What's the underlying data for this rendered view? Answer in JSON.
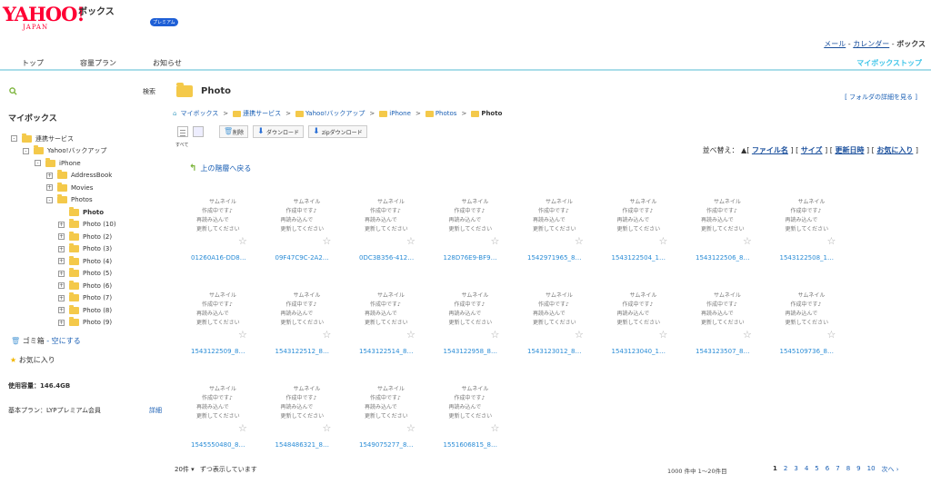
{
  "header": {
    "logo": "YAHOO!",
    "logo_sub": "JAPAN",
    "service": "ボックス",
    "premium_badge": "プレミアム",
    "links": {
      "mail": "メール",
      "calendar": "カレンダー",
      "box": "ボックス",
      "sep": " - "
    },
    "nav": [
      "トップ",
      "容量プラン",
      "お知らせ"
    ],
    "mybox_top": "マイボックストップ"
  },
  "sidebar": {
    "search_button": "検索",
    "title": "マイボックス",
    "tree": [
      {
        "label": "連携サービス",
        "toggle": "-",
        "level": 0
      },
      {
        "label": "Yahoo!バックアップ",
        "toggle": "-",
        "level": 1
      },
      {
        "label": "iPhone",
        "toggle": "-",
        "level": 2
      },
      {
        "label": "AddressBook",
        "toggle": "+",
        "level": 3
      },
      {
        "label": "Movies",
        "toggle": "+",
        "level": 3
      },
      {
        "label": "Photos",
        "toggle": "-",
        "level": 3
      },
      {
        "label": "Photo",
        "toggle": "",
        "level": 4,
        "current": true
      },
      {
        "label": "Photo (10)",
        "toggle": "+",
        "level": 4
      },
      {
        "label": "Photo (2)",
        "toggle": "+",
        "level": 4
      },
      {
        "label": "Photo (3)",
        "toggle": "+",
        "level": 4
      },
      {
        "label": "Photo (4)",
        "toggle": "+",
        "level": 4
      },
      {
        "label": "Photo (5)",
        "toggle": "+",
        "level": 4
      },
      {
        "label": "Photo (6)",
        "toggle": "+",
        "level": 4
      },
      {
        "label": "Photo (7)",
        "toggle": "+",
        "level": 4
      },
      {
        "label": "Photo (8)",
        "toggle": "+",
        "level": 4
      },
      {
        "label": "Photo (9)",
        "toggle": "+",
        "level": 4
      }
    ],
    "trash_label": "ゴミ箱",
    "trash_action": "- 空にする",
    "favorites": "お気に入り",
    "capacity": "使用容量：146.4GB",
    "plan": "基本プラン：LYPプレミアム会員",
    "plan_detail": "詳細"
  },
  "main": {
    "title": "Photo",
    "folder_detail": "[ フォルダの詳細を見る ]",
    "breadcrumb": [
      "マイボックス",
      "連携サービス",
      "Yahoo!バックアップ",
      "iPhone",
      "Photos",
      "Photo"
    ],
    "toolbar": {
      "delete": "削除",
      "download": "ダウンロード",
      "zip_download": "zipダウンロード",
      "all": "すべて"
    },
    "sort": {
      "label": "並べ替え：",
      "options": [
        "ファイル名",
        "サイズ",
        "更新日時",
        "お気に入り"
      ]
    },
    "up_link": "上の階層へ戻る",
    "thumb_text": [
      "サムネイル",
      "作成中です♪",
      "再読み込んで",
      "更新してください"
    ],
    "files": [
      "01260A16-DD8…",
      "09F47C9C-2A2…",
      "0DC3B356-412…",
      "128D76E9-BF9…",
      "1542971965_8…",
      "1543122504_1…",
      "1543122506_8…",
      "1543122508_1…",
      "1543122509_8…",
      "1543122512_8…",
      "1543122514_8…",
      "1543122958_8…",
      "1543123012_8…",
      "1543123040_1…",
      "1543123507_8…",
      "1545109736_8…",
      "1545550480_8…",
      "1548486321_8…",
      "1549075277_8…",
      "1551606815_8…"
    ],
    "per_page": "20件",
    "per_page_text": "ずつ表示しています",
    "pager_info": "1000 件中 1～20件目",
    "pages": [
      "1",
      "2",
      "3",
      "4",
      "5",
      "6",
      "7",
      "8",
      "9",
      "10"
    ],
    "next": "次へ ›"
  }
}
